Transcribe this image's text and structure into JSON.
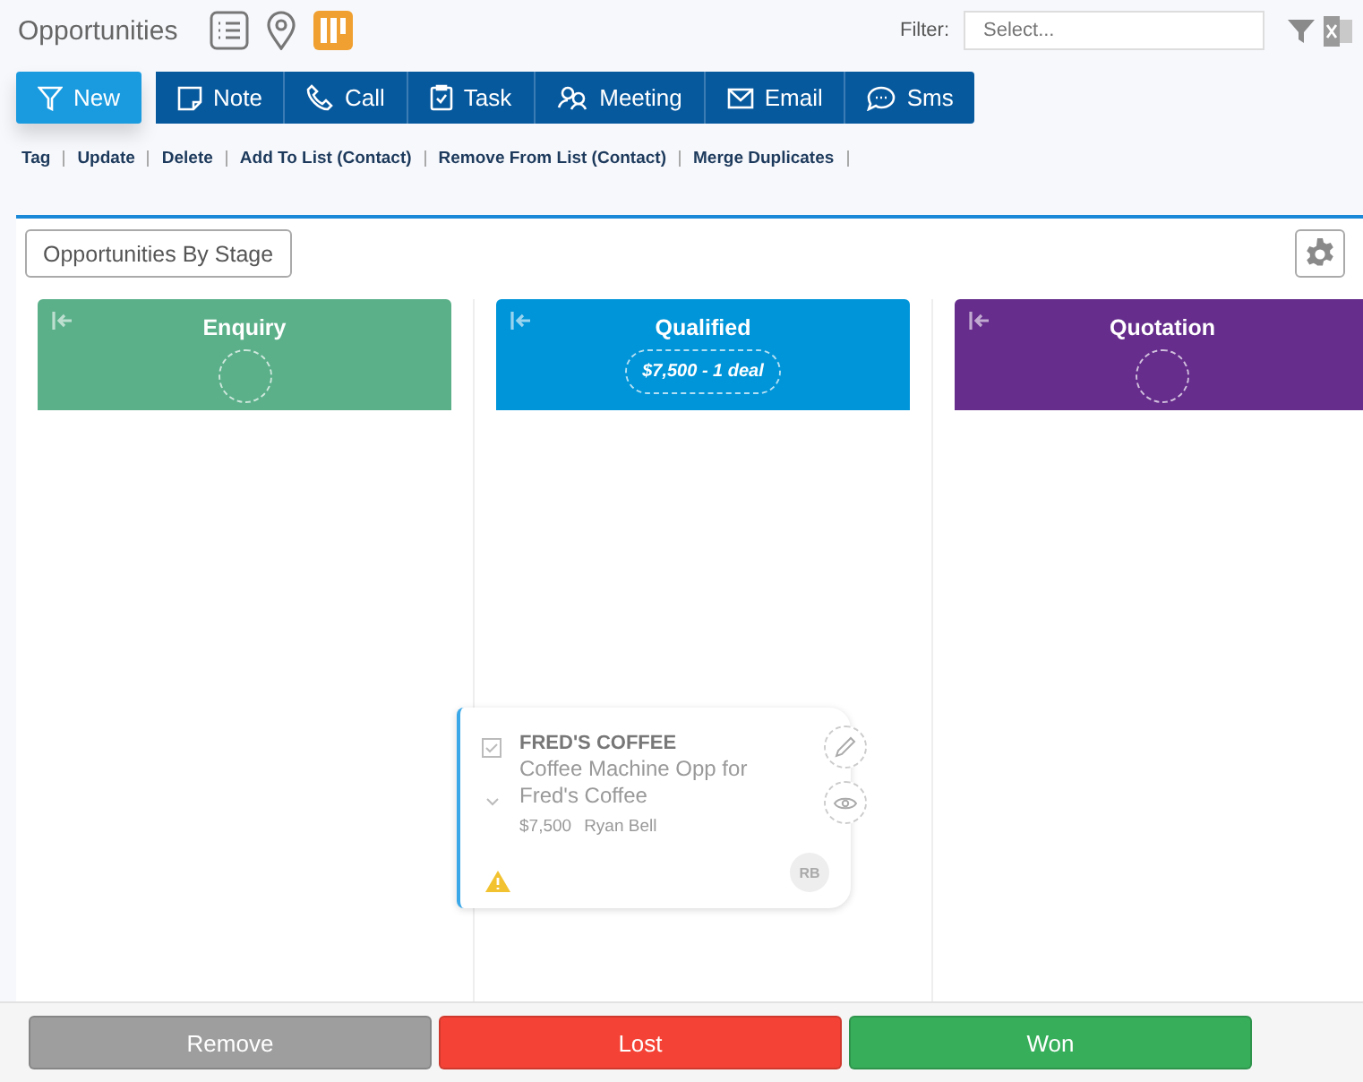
{
  "page_title": "Opportunities",
  "views": [
    {
      "kind": "list",
      "selected": false
    },
    {
      "kind": "map",
      "selected": false
    },
    {
      "kind": "board",
      "selected": true
    }
  ],
  "filter": {
    "label": "Filter:",
    "placeholder": "Select..."
  },
  "toolbar": [
    {
      "kind": "filter",
      "label": "New",
      "primary": true
    },
    {
      "kind": "note",
      "label": "Note",
      "primary": false
    },
    {
      "kind": "call",
      "label": "Call",
      "primary": false
    },
    {
      "kind": "task",
      "label": "Task",
      "primary": false
    },
    {
      "kind": "meeting",
      "label": "Meeting",
      "primary": false
    },
    {
      "kind": "email",
      "label": "Email",
      "primary": false
    },
    {
      "kind": "sms",
      "label": "Sms",
      "primary": false
    }
  ],
  "actions": [
    "Tag",
    "Update",
    "Delete",
    "Add To List (Contact)",
    "Remove From List (Contact)",
    "Merge Duplicates"
  ],
  "board": {
    "title": "Opportunities By Stage",
    "columns": [
      {
        "name": "Enquiry",
        "color": "#5bb08a"
      },
      {
        "name": "Qualified",
        "color": "#0095d9",
        "summary": "$7,500 - 1 deal"
      },
      {
        "name": "Quotation",
        "color": "#662d8c"
      }
    ],
    "card": {
      "title": "FRED'S COFFEE",
      "subtitle": "Coffee Machine Opp for Fred's Coffee",
      "amount": "$7,500",
      "owner": "Ryan Bell",
      "initials": "RB",
      "warning": true
    }
  },
  "bottom_buttons": [
    {
      "label": "Remove",
      "color": "#9e9e9e"
    },
    {
      "label": "Lost",
      "color": "#f44336"
    },
    {
      "label": "Won",
      "color": "#37ae5a"
    }
  ]
}
